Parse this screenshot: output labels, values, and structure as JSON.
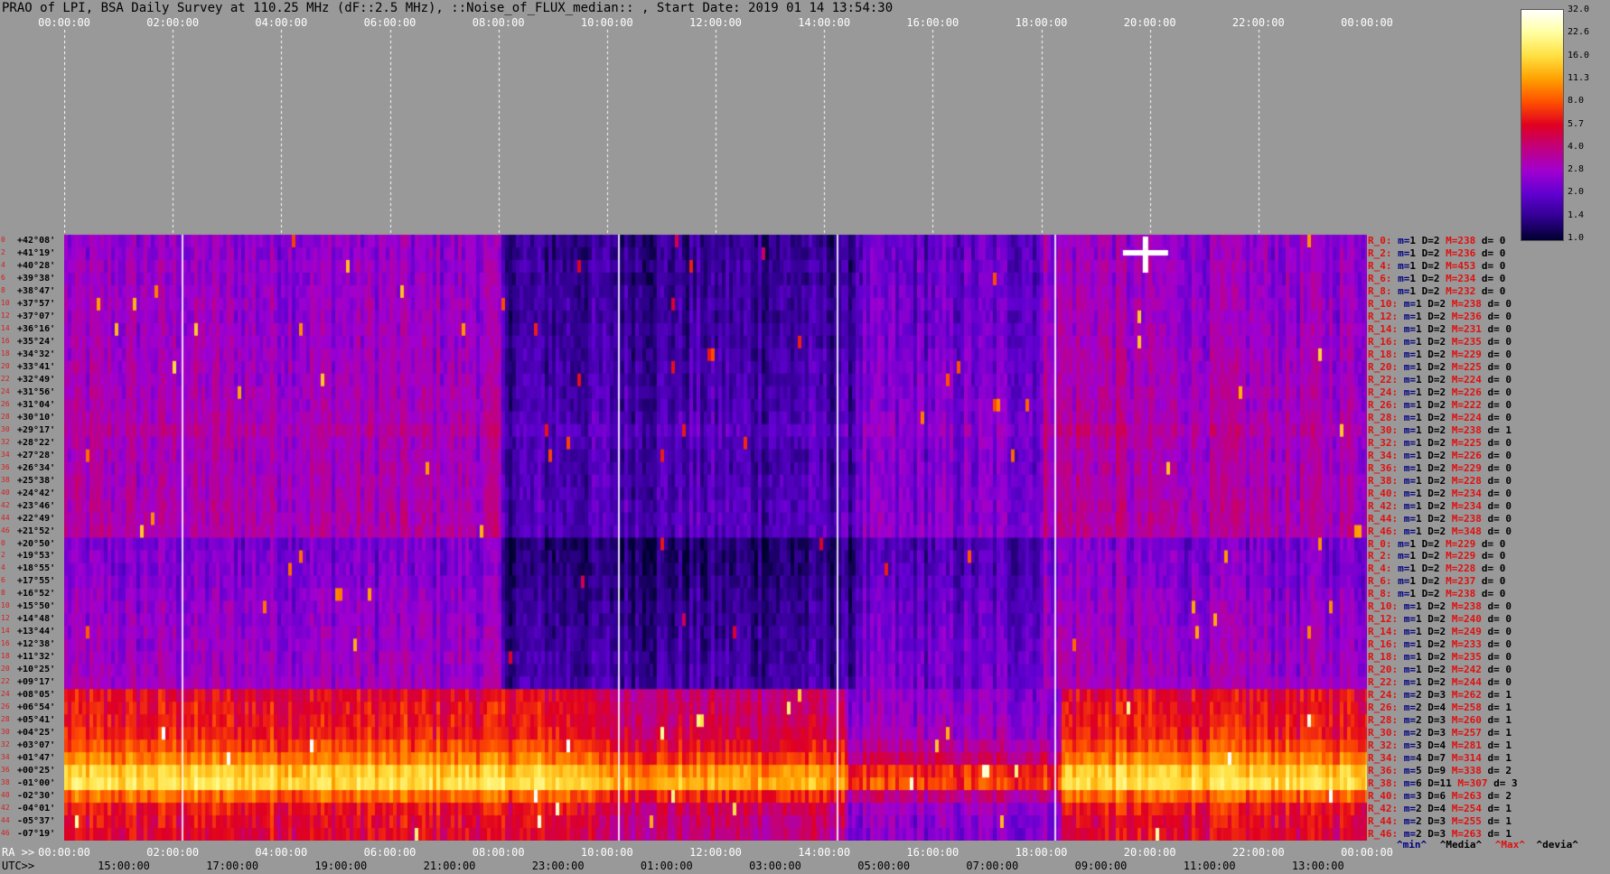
{
  "title": "PRAO of LPI, BSA Daily Survey at 110.25 MHz (dF::2.5 MHz), ::Noise_of_FLUX_median:: , Start Date: 2019 01 14 13:54:30",
  "top_time_labels": [
    "00:00:00",
    "02:00:00",
    "04:00:00",
    "06:00:00",
    "08:00:00",
    "10:00:00",
    "12:00:00",
    "14:00:00",
    "16:00:00",
    "18:00:00",
    "20:00:00",
    "22:00:00",
    "00:00:00"
  ],
  "ra_prefix": "RA >>",
  "ra_labels": [
    "00:00:00",
    "02:00:00",
    "04:00:00",
    "06:00:00",
    "08:00:00",
    "10:00:00",
    "12:00:00",
    "14:00:00",
    "16:00:00",
    "18:00:00",
    "20:00:00",
    "22:00:00",
    "00:00:00"
  ],
  "utc_prefix": "UTC>>",
  "utc_labels": [
    "15:00:00",
    "17:00:00",
    "19:00:00",
    "21:00:00",
    "23:00:00",
    "01:00:00",
    "03:00:00",
    "05:00:00",
    "07:00:00",
    "09:00:00",
    "11:00:00",
    "13:00:00"
  ],
  "colorbar": {
    "ticks": [
      "32.0",
      "22.6",
      "16.0",
      "11.3",
      "8.0",
      "5.7",
      "4.0",
      "2.8",
      "2.0",
      "1.4",
      "1.0"
    ],
    "colors": [
      "#ffffff",
      "#ffffa0",
      "#ffe040",
      "#ffa000",
      "#ff5000",
      "#e00020",
      "#c00080",
      "#a000d0",
      "#6000d0",
      "#300090",
      "#000030"
    ]
  },
  "legend": [
    "^min^",
    "^Media^",
    "^Max^",
    "^devia^"
  ],
  "chart_data": {
    "type": "heatmap",
    "title": "PRAO of LPI, BSA Daily Survey at 110.25 MHz (dF::2.5 MHz), ::Noise_of_FLUX_median:: , Start Date: 2019 01 14 13:54:30",
    "x_axis_top": "time 00:00:00 to 00:00:00 (24 h)",
    "y_labels": [
      "+42°08'",
      "+41°19'",
      "+40°28'",
      "+39°38'",
      "+38°47'",
      "+37°57'",
      "+37°07'",
      "+36°16'",
      "+35°24'",
      "+34°32'",
      "+33°41'",
      "+32°49'",
      "+31°56'",
      "+31°04'",
      "+30°10'",
      "+29°17'",
      "+28°22'",
      "+27°28'",
      "+26°34'",
      "+25°38'",
      "+24°42'",
      "+23°46'",
      "+22°49'",
      "+21°52'",
      "+20°50'",
      "+19°53'",
      "+18°55'",
      "+17°55'",
      "+16°52'",
      "+15°50'",
      "+14°48'",
      "+13°44'",
      "+12°38'",
      "+11°32'",
      "+10°25'",
      "+09°17'",
      "+08°05'",
      "+06°54'",
      "+05°41'",
      "+04°25'",
      "+03°07'",
      "+01°47'",
      "+00°25'",
      "-01°00'",
      "-02°30'",
      "-04°01'",
      "-05°37'",
      "-07°19'"
    ],
    "row_index_labels": [
      "0",
      "2",
      "4",
      "6",
      "8",
      "10",
      "12",
      "14",
      "16",
      "18",
      "20",
      "22",
      "24",
      "26",
      "28",
      "30",
      "32",
      "34",
      "36",
      "38",
      "40",
      "42",
      "44",
      "46",
      "0",
      "2",
      "4",
      "6",
      "8",
      "10",
      "12",
      "14",
      "16",
      "18",
      "20",
      "22",
      "24",
      "26",
      "28",
      "30",
      "32",
      "34",
      "36",
      "38",
      "40",
      "42",
      "44",
      "46"
    ],
    "row_stats": [
      {
        "label": "R_0:",
        "min": "1",
        "d": "2",
        "max": "238",
        "dev": "0"
      },
      {
        "label": "R_2:",
        "min": "1",
        "d": "2",
        "max": "236",
        "dev": "0"
      },
      {
        "label": "R_4:",
        "min": "1",
        "d": "2",
        "max": "453",
        "dev": "0"
      },
      {
        "label": "R_6:",
        "min": "1",
        "d": "2",
        "max": "234",
        "dev": "0"
      },
      {
        "label": "R_8:",
        "min": "1",
        "d": "2",
        "max": "232",
        "dev": "0"
      },
      {
        "label": "R_10:",
        "min": "1",
        "d": "2",
        "max": "238",
        "dev": "0"
      },
      {
        "label": "R_12:",
        "min": "1",
        "d": "2",
        "max": "236",
        "dev": "0"
      },
      {
        "label": "R_14:",
        "min": "1",
        "d": "2",
        "max": "231",
        "dev": "0"
      },
      {
        "label": "R_16:",
        "min": "1",
        "d": "2",
        "max": "235",
        "dev": "0"
      },
      {
        "label": "R_18:",
        "min": "1",
        "d": "2",
        "max": "229",
        "dev": "0"
      },
      {
        "label": "R_20:",
        "min": "1",
        "d": "2",
        "max": "225",
        "dev": "0"
      },
      {
        "label": "R_22:",
        "min": "1",
        "d": "2",
        "max": "224",
        "dev": "0"
      },
      {
        "label": "R_24:",
        "min": "1",
        "d": "2",
        "max": "226",
        "dev": "0"
      },
      {
        "label": "R_26:",
        "min": "1",
        "d": "2",
        "max": "222",
        "dev": "0"
      },
      {
        "label": "R_28:",
        "min": "1",
        "d": "2",
        "max": "224",
        "dev": "0"
      },
      {
        "label": "R_30:",
        "min": "1",
        "d": "2",
        "max": "238",
        "dev": "1"
      },
      {
        "label": "R_32:",
        "min": "1",
        "d": "2",
        "max": "225",
        "dev": "0"
      },
      {
        "label": "R_34:",
        "min": "1",
        "d": "2",
        "max": "226",
        "dev": "0"
      },
      {
        "label": "R_36:",
        "min": "1",
        "d": "2",
        "max": "229",
        "dev": "0"
      },
      {
        "label": "R_38:",
        "min": "1",
        "d": "2",
        "max": "228",
        "dev": "0"
      },
      {
        "label": "R_40:",
        "min": "1",
        "d": "2",
        "max": "234",
        "dev": "0"
      },
      {
        "label": "R_42:",
        "min": "1",
        "d": "2",
        "max": "234",
        "dev": "0"
      },
      {
        "label": "R_44:",
        "min": "1",
        "d": "2",
        "max": "238",
        "dev": "0"
      },
      {
        "label": "R_46:",
        "min": "1",
        "d": "2",
        "max": "348",
        "dev": "0"
      },
      {
        "label": "R_0:",
        "min": "1",
        "d": "2",
        "max": "229",
        "dev": "0"
      },
      {
        "label": "R_2:",
        "min": "1",
        "d": "2",
        "max": "229",
        "dev": "0"
      },
      {
        "label": "R_4:",
        "min": "1",
        "d": "2",
        "max": "228",
        "dev": "0"
      },
      {
        "label": "R_6:",
        "min": "1",
        "d": "2",
        "max": "237",
        "dev": "0"
      },
      {
        "label": "R_8:",
        "min": "1",
        "d": "2",
        "max": "238",
        "dev": "0"
      },
      {
        "label": "R_10:",
        "min": "1",
        "d": "2",
        "max": "238",
        "dev": "0"
      },
      {
        "label": "R_12:",
        "min": "1",
        "d": "2",
        "max": "240",
        "dev": "0"
      },
      {
        "label": "R_14:",
        "min": "1",
        "d": "2",
        "max": "249",
        "dev": "0"
      },
      {
        "label": "R_16:",
        "min": "1",
        "d": "2",
        "max": "233",
        "dev": "0"
      },
      {
        "label": "R_18:",
        "min": "1",
        "d": "2",
        "max": "235",
        "dev": "0"
      },
      {
        "label": "R_20:",
        "min": "1",
        "d": "2",
        "max": "242",
        "dev": "0"
      },
      {
        "label": "R_22:",
        "min": "1",
        "d": "2",
        "max": "244",
        "dev": "0"
      },
      {
        "label": "R_24:",
        "min": "2",
        "d": "3",
        "max": "262",
        "dev": "1"
      },
      {
        "label": "R_26:",
        "min": "2",
        "d": "4",
        "max": "258",
        "dev": "1"
      },
      {
        "label": "R_28:",
        "min": "2",
        "d": "3",
        "max": "260",
        "dev": "1"
      },
      {
        "label": "R_30:",
        "min": "2",
        "d": "3",
        "max": "257",
        "dev": "1"
      },
      {
        "label": "R_32:",
        "min": "3",
        "d": "4",
        "max": "281",
        "dev": "1"
      },
      {
        "label": "R_34:",
        "min": "4",
        "d": "7",
        "max": "314",
        "dev": "1"
      },
      {
        "label": "R_36:",
        "min": "5",
        "d": "9",
        "max": "338",
        "dev": "2"
      },
      {
        "label": "R_38:",
        "min": "6",
        "d": "11",
        "max": "307",
        "dev": "3"
      },
      {
        "label": "R_40:",
        "min": "3",
        "d": "6",
        "max": "263",
        "dev": "2"
      },
      {
        "label": "R_42:",
        "min": "2",
        "d": "4",
        "max": "254",
        "dev": "1"
      },
      {
        "label": "R_44:",
        "min": "2",
        "d": "3",
        "max": "255",
        "dev": "1"
      },
      {
        "label": "R_46:",
        "min": "2",
        "d": "3",
        "max": "263",
        "dev": "1"
      }
    ],
    "row_base_levels": [
      2.6,
      2.6,
      2.7,
      2.6,
      2.7,
      2.8,
      2.7,
      2.8,
      2.8,
      2.9,
      2.9,
      2.9,
      3.0,
      3.0,
      3.1,
      3.4,
      3.1,
      3.0,
      3.0,
      3.1,
      3.1,
      3.2,
      3.2,
      3.3,
      2.2,
      2.3,
      2.3,
      2.4,
      2.5,
      2.6,
      2.6,
      2.7,
      2.7,
      2.8,
      2.8,
      2.9,
      5.5,
      5.8,
      6.0,
      6.3,
      7.5,
      9.5,
      14.0,
      16.0,
      8.5,
      6.0,
      5.5,
      5.3
    ],
    "colorbar_range": [
      1.0,
      32.0
    ]
  }
}
